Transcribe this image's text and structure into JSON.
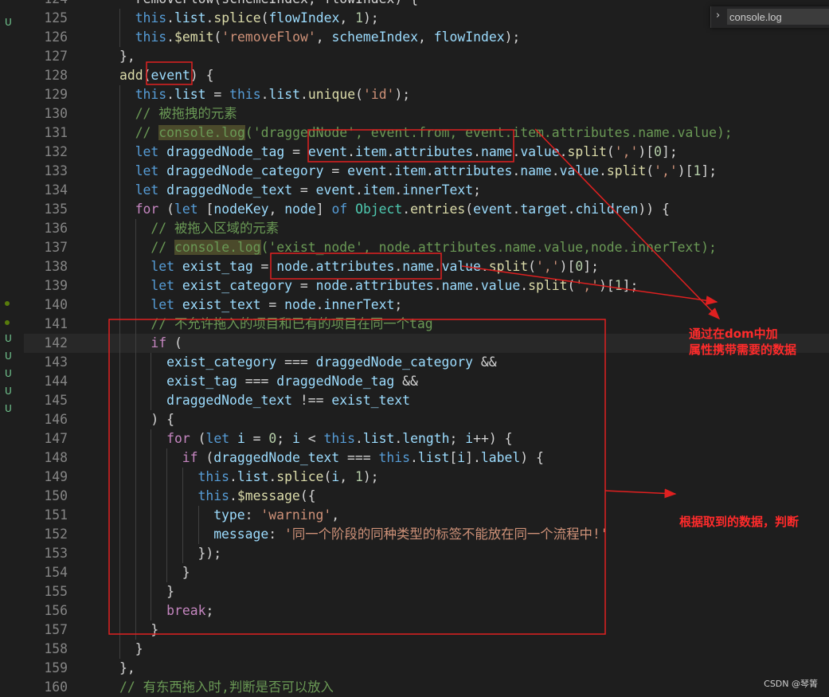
{
  "search": {
    "value": "console.log",
    "chevron": "›"
  },
  "scm_markers": [
    "U",
    "U",
    "U",
    "U",
    "U",
    "U"
  ],
  "annotations": {
    "note1_line1": "通过在dom中加",
    "note1_line2": "属性携带需要的数据",
    "note2": "根据取到的数据，判断",
    "color": "#ff2b2b"
  },
  "watermark": "CSDN @琴箐",
  "theme": {
    "keyword": "#569cd6",
    "control": "#c586c0",
    "variable": "#9cdcfe",
    "function": "#dcdcaa",
    "string": "#ce9178",
    "number": "#b5cea8",
    "class": "#4ec9b0",
    "comment": "#6a9955",
    "text": "#d4d4d4"
  },
  "code_lines": [
    {
      "num": "124",
      "indent": 0,
      "tokens": [
        [
          "pun",
          "  removeFlow(schemeIndex, flowIndex) {"
        ]
      ]
    },
    {
      "num": "125",
      "indent": 2,
      "tokens": [
        [
          "kw",
          "this"
        ],
        [
          "pun",
          "."
        ],
        [
          "var",
          "list"
        ],
        [
          "pun",
          "."
        ],
        [
          "fn",
          "splice"
        ],
        [
          "pun",
          "("
        ],
        [
          "var",
          "flowIndex"
        ],
        [
          "pun",
          ", "
        ],
        [
          "num",
          "1"
        ],
        [
          "pun",
          ");"
        ]
      ]
    },
    {
      "num": "126",
      "indent": 2,
      "tokens": [
        [
          "kw",
          "this"
        ],
        [
          "pun",
          "."
        ],
        [
          "fn",
          "$emit"
        ],
        [
          "pun",
          "("
        ],
        [
          "str",
          "'removeFlow'"
        ],
        [
          "pun",
          ", "
        ],
        [
          "var",
          "schemeIndex"
        ],
        [
          "pun",
          ", "
        ],
        [
          "var",
          "flowIndex"
        ],
        [
          "pun",
          ");"
        ]
      ]
    },
    {
      "num": "127",
      "indent": 1,
      "tokens": [
        [
          "pun",
          "},"
        ]
      ]
    },
    {
      "num": "128",
      "indent": 1,
      "tokens": [
        [
          "fn",
          "add"
        ],
        [
          "pun",
          "("
        ],
        [
          "var",
          "event"
        ],
        [
          "pun",
          ") {"
        ]
      ]
    },
    {
      "num": "129",
      "indent": 2,
      "tokens": [
        [
          "kw",
          "this"
        ],
        [
          "pun",
          "."
        ],
        [
          "var",
          "list"
        ],
        [
          "pun",
          " = "
        ],
        [
          "kw",
          "this"
        ],
        [
          "pun",
          "."
        ],
        [
          "var",
          "list"
        ],
        [
          "pun",
          "."
        ],
        [
          "fn",
          "unique"
        ],
        [
          "pun",
          "("
        ],
        [
          "str",
          "'id'"
        ],
        [
          "pun",
          ");"
        ]
      ]
    },
    {
      "num": "130",
      "indent": 2,
      "tokens": [
        [
          "cmt",
          "// 被拖拽的元素"
        ]
      ]
    },
    {
      "num": "131",
      "indent": 2,
      "tokens": [
        [
          "cmt",
          "// "
        ],
        [
          "cmtHi",
          "console.log"
        ],
        [
          "cmt",
          "('draggedNode', event.from, event.item.attributes.name.value);"
        ]
      ]
    },
    {
      "num": "132",
      "indent": 2,
      "tokens": [
        [
          "kw",
          "let "
        ],
        [
          "var",
          "draggedNode_tag"
        ],
        [
          "pun",
          " = "
        ],
        [
          "var",
          "event"
        ],
        [
          "pun",
          "."
        ],
        [
          "var",
          "item"
        ],
        [
          "pun",
          "."
        ],
        [
          "var",
          "attributes"
        ],
        [
          "pun",
          "."
        ],
        [
          "var",
          "name"
        ],
        [
          "pun",
          "."
        ],
        [
          "var",
          "value"
        ],
        [
          "pun",
          "."
        ],
        [
          "fn",
          "split"
        ],
        [
          "pun",
          "("
        ],
        [
          "str",
          "','"
        ],
        [
          "pun",
          ")["
        ],
        [
          "num",
          "0"
        ],
        [
          "pun",
          "];"
        ]
      ]
    },
    {
      "num": "133",
      "indent": 2,
      "tokens": [
        [
          "kw",
          "let "
        ],
        [
          "var",
          "draggedNode_category"
        ],
        [
          "pun",
          " = "
        ],
        [
          "var",
          "event"
        ],
        [
          "pun",
          "."
        ],
        [
          "var",
          "item"
        ],
        [
          "pun",
          "."
        ],
        [
          "var",
          "attributes"
        ],
        [
          "pun",
          "."
        ],
        [
          "var",
          "name"
        ],
        [
          "pun",
          "."
        ],
        [
          "var",
          "value"
        ],
        [
          "pun",
          "."
        ],
        [
          "fn",
          "split"
        ],
        [
          "pun",
          "("
        ],
        [
          "str",
          "','"
        ],
        [
          "pun",
          ")["
        ],
        [
          "num",
          "1"
        ],
        [
          "pun",
          "];"
        ]
      ]
    },
    {
      "num": "134",
      "indent": 2,
      "tokens": [
        [
          "kw",
          "let "
        ],
        [
          "var",
          "draggedNode_text"
        ],
        [
          "pun",
          " = "
        ],
        [
          "var",
          "event"
        ],
        [
          "pun",
          "."
        ],
        [
          "var",
          "item"
        ],
        [
          "pun",
          "."
        ],
        [
          "var",
          "innerText"
        ],
        [
          "pun",
          ";"
        ]
      ]
    },
    {
      "num": "135",
      "indent": 2,
      "tokens": [
        [
          "ctl",
          "for "
        ],
        [
          "pun",
          "("
        ],
        [
          "kw",
          "let "
        ],
        [
          "pun",
          "["
        ],
        [
          "var",
          "nodeKey"
        ],
        [
          "pun",
          ", "
        ],
        [
          "var",
          "node"
        ],
        [
          "pun",
          "] "
        ],
        [
          "kw",
          "of "
        ],
        [
          "cls",
          "Object"
        ],
        [
          "pun",
          "."
        ],
        [
          "fn",
          "entries"
        ],
        [
          "pun",
          "("
        ],
        [
          "var",
          "event"
        ],
        [
          "pun",
          "."
        ],
        [
          "var",
          "target"
        ],
        [
          "pun",
          "."
        ],
        [
          "var",
          "children"
        ],
        [
          "pun",
          ")) {"
        ]
      ]
    },
    {
      "num": "136",
      "indent": 3,
      "tokens": [
        [
          "cmt",
          "// 被拖入区域的元素"
        ]
      ]
    },
    {
      "num": "137",
      "indent": 3,
      "tokens": [
        [
          "cmt",
          "// "
        ],
        [
          "cmtHi",
          "console.log"
        ],
        [
          "cmt",
          "('exist_node', node.attributes.name.value,node.innerText);"
        ]
      ]
    },
    {
      "num": "138",
      "indent": 3,
      "tokens": [
        [
          "kw",
          "let "
        ],
        [
          "var",
          "exist_tag"
        ],
        [
          "pun",
          " = "
        ],
        [
          "var",
          "node"
        ],
        [
          "pun",
          "."
        ],
        [
          "var",
          "attributes"
        ],
        [
          "pun",
          "."
        ],
        [
          "var",
          "name"
        ],
        [
          "pun",
          "."
        ],
        [
          "var",
          "value"
        ],
        [
          "pun",
          "."
        ],
        [
          "fn",
          "split"
        ],
        [
          "pun",
          "("
        ],
        [
          "str",
          "','"
        ],
        [
          "pun",
          ")["
        ],
        [
          "num",
          "0"
        ],
        [
          "pun",
          "];"
        ]
      ]
    },
    {
      "num": "139",
      "indent": 3,
      "tokens": [
        [
          "kw",
          "let "
        ],
        [
          "var",
          "exist_category"
        ],
        [
          "pun",
          " = "
        ],
        [
          "var",
          "node"
        ],
        [
          "pun",
          "."
        ],
        [
          "var",
          "attributes"
        ],
        [
          "pun",
          "."
        ],
        [
          "var",
          "name"
        ],
        [
          "pun",
          "."
        ],
        [
          "var",
          "value"
        ],
        [
          "pun",
          "."
        ],
        [
          "fn",
          "split"
        ],
        [
          "pun",
          "("
        ],
        [
          "str",
          "','"
        ],
        [
          "pun",
          ")["
        ],
        [
          "num",
          "1"
        ],
        [
          "pun",
          "];"
        ]
      ]
    },
    {
      "num": "140",
      "indent": 3,
      "tokens": [
        [
          "kw",
          "let "
        ],
        [
          "var",
          "exist_text"
        ],
        [
          "pun",
          " = "
        ],
        [
          "var",
          "node"
        ],
        [
          "pun",
          "."
        ],
        [
          "var",
          "innerText"
        ],
        [
          "pun",
          ";"
        ]
      ]
    },
    {
      "num": "141",
      "indent": 3,
      "tokens": [
        [
          "cmt",
          "// 不允许拖入的项目和已有的项目在同一个tag"
        ]
      ]
    },
    {
      "num": "142",
      "indent": 3,
      "tokens": [
        [
          "ctl",
          "if "
        ],
        [
          "pun",
          "("
        ]
      ]
    },
    {
      "num": "143",
      "indent": 4,
      "tokens": [
        [
          "var",
          "exist_category"
        ],
        [
          "pun",
          " === "
        ],
        [
          "var",
          "draggedNode_category"
        ],
        [
          "pun",
          " &&"
        ]
      ]
    },
    {
      "num": "144",
      "indent": 4,
      "tokens": [
        [
          "var",
          "exist_tag"
        ],
        [
          "pun",
          " === "
        ],
        [
          "var",
          "draggedNode_tag"
        ],
        [
          "pun",
          " &&"
        ]
      ]
    },
    {
      "num": "145",
      "indent": 4,
      "tokens": [
        [
          "var",
          "draggedNode_text"
        ],
        [
          "pun",
          " !== "
        ],
        [
          "var",
          "exist_text"
        ]
      ]
    },
    {
      "num": "146",
      "indent": 3,
      "tokens": [
        [
          "pun",
          ") {"
        ]
      ]
    },
    {
      "num": "147",
      "indent": 4,
      "tokens": [
        [
          "ctl",
          "for "
        ],
        [
          "pun",
          "("
        ],
        [
          "kw",
          "let "
        ],
        [
          "var",
          "i"
        ],
        [
          "pun",
          " = "
        ],
        [
          "num",
          "0"
        ],
        [
          "pun",
          "; "
        ],
        [
          "var",
          "i"
        ],
        [
          "pun",
          " < "
        ],
        [
          "kw",
          "this"
        ],
        [
          "pun",
          "."
        ],
        [
          "var",
          "list"
        ],
        [
          "pun",
          "."
        ],
        [
          "var",
          "length"
        ],
        [
          "pun",
          "; "
        ],
        [
          "var",
          "i"
        ],
        [
          "pun",
          "++) {"
        ]
      ]
    },
    {
      "num": "148",
      "indent": 5,
      "tokens": [
        [
          "ctl",
          "if "
        ],
        [
          "pun",
          "("
        ],
        [
          "var",
          "draggedNode_text"
        ],
        [
          "pun",
          " === "
        ],
        [
          "kw",
          "this"
        ],
        [
          "pun",
          "."
        ],
        [
          "var",
          "list"
        ],
        [
          "pun",
          "["
        ],
        [
          "var",
          "i"
        ],
        [
          "pun",
          "]."
        ],
        [
          "var",
          "label"
        ],
        [
          "pun",
          ") {"
        ]
      ]
    },
    {
      "num": "149",
      "indent": 6,
      "tokens": [
        [
          "kw",
          "this"
        ],
        [
          "pun",
          "."
        ],
        [
          "var",
          "list"
        ],
        [
          "pun",
          "."
        ],
        [
          "fn",
          "splice"
        ],
        [
          "pun",
          "("
        ],
        [
          "var",
          "i"
        ],
        [
          "pun",
          ", "
        ],
        [
          "num",
          "1"
        ],
        [
          "pun",
          ");"
        ]
      ]
    },
    {
      "num": "150",
      "indent": 6,
      "tokens": [
        [
          "kw",
          "this"
        ],
        [
          "pun",
          "."
        ],
        [
          "fn",
          "$message"
        ],
        [
          "pun",
          "({"
        ]
      ]
    },
    {
      "num": "151",
      "indent": 7,
      "tokens": [
        [
          "var",
          "type"
        ],
        [
          "pun",
          ": "
        ],
        [
          "str",
          "'warning'"
        ],
        [
          "pun",
          ","
        ]
      ]
    },
    {
      "num": "152",
      "indent": 7,
      "tokens": [
        [
          "var",
          "message"
        ],
        [
          "pun",
          ": "
        ],
        [
          "str",
          "'同一个阶段的同种类型的标签不能放在同一个流程中!'"
        ]
      ]
    },
    {
      "num": "153",
      "indent": 6,
      "tokens": [
        [
          "pun",
          "});"
        ]
      ]
    },
    {
      "num": "154",
      "indent": 5,
      "tokens": [
        [
          "pun",
          "}"
        ]
      ]
    },
    {
      "num": "155",
      "indent": 4,
      "tokens": [
        [
          "pun",
          "}"
        ]
      ]
    },
    {
      "num": "156",
      "indent": 4,
      "tokens": [
        [
          "ctl",
          "break"
        ],
        [
          "pun",
          ";"
        ]
      ]
    },
    {
      "num": "157",
      "indent": 3,
      "tokens": [
        [
          "pun",
          "}"
        ]
      ]
    },
    {
      "num": "158",
      "indent": 2,
      "tokens": [
        [
          "pun",
          "}"
        ]
      ]
    },
    {
      "num": "159",
      "indent": 1,
      "tokens": [
        [
          "pun",
          "},"
        ]
      ]
    },
    {
      "num": "160",
      "indent": 1,
      "tokens": [
        [
          "cmt",
          "// 有东西拖入时,判断是否可以放入"
        ]
      ]
    }
  ]
}
